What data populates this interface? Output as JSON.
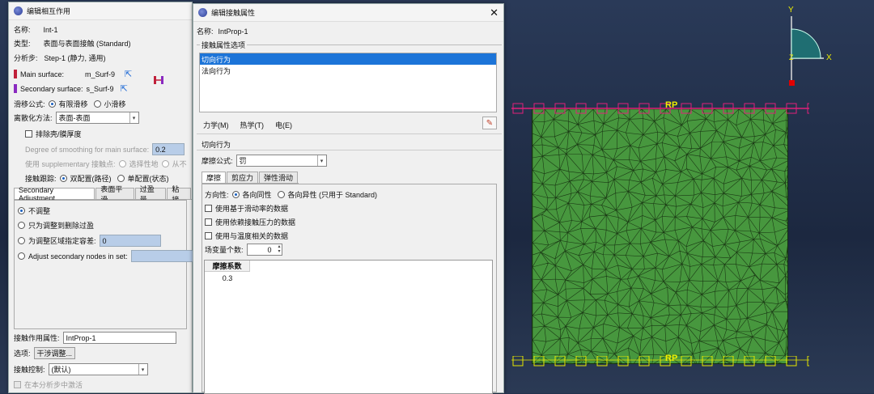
{
  "viewport": {
    "rp_top": "RP",
    "rp_bottom": "RP",
    "triad": {
      "y": "Y",
      "x": "X",
      "z": "Z"
    },
    "colors": {
      "mesh": "#47973e",
      "edges": "#1b3a15",
      "constraint_top": "#e0207a",
      "constraint_bottom": "#e6e600",
      "triad": "#1f6e72"
    }
  },
  "left_dialog": {
    "title": "编辑相互作用",
    "name_label": "名称:",
    "name_value": "Int-1",
    "type_label": "类型:",
    "type_value": "表面与表面接触 (Standard)",
    "step_label": "分析步:",
    "step_value": "Step-1 (静力, 通用)",
    "main_surface_label": "Main surface:",
    "main_surface_value": "m_Surf-9",
    "secondary_surface_label": "Secondary surface:",
    "secondary_surface_value": "s_Surf-9",
    "sliding_label": "滑移公式:",
    "sliding_finite": "有限滑移",
    "sliding_small": "小滑移",
    "discretization_label": "离散化方法:",
    "discretization_value": "表面-表面",
    "exclude_shell": "排除壳/膜厚度",
    "smoothing_label": "Degree of smoothing for main surface:",
    "smoothing_value": "0.2",
    "supplementary_label": "使用 supplementary 接触点:",
    "supplementary_opt1": "选择性地",
    "supplementary_opt2": "从不",
    "tracking_label": "接触跟踪:",
    "tracking_opt1": "双配置(路径)",
    "tracking_opt2": "单配置(状态)",
    "tabs": [
      "Secondary Adjustment",
      "表面平滑",
      "过盈量",
      "粘接"
    ],
    "adjust_none": "不调整",
    "adjust_remove": "只为调整到删除过盈",
    "adjust_tolerance": "为调整区域指定容差:",
    "adjust_tolerance_value": "0",
    "adjust_nodes": "Adjust secondary nodes in set:",
    "property_label": "接触作用属性:",
    "property_value": "IntProp-1",
    "options_label": "选项:",
    "options_button": "干涉调整...",
    "control_label": "接触控制:",
    "control_value": "(默认)",
    "activate_label": "在本分析步中激活"
  },
  "right_dialog": {
    "title": "编辑接触属性",
    "name_label": "名称:",
    "name_value": "IntProp-1",
    "options_group": "接触属性选项",
    "options": [
      "切向行为",
      "法向行为"
    ],
    "menus": [
      "力学(M)",
      "热学(T)",
      "电(E)"
    ],
    "section_title": "切向行为",
    "friction_label": "摩擦公式:",
    "friction_value": "罚",
    "tabs": [
      "摩擦",
      "剪应力",
      "弹性滑动"
    ],
    "direction_label": "方向性:",
    "direction_iso": "各向同性",
    "direction_aniso": "各向异性 (只用于 Standard)",
    "chk_slip": "使用基于滑动率的数据",
    "chk_pressure": "使用依赖接触压力的数据",
    "chk_temp": "使用与温度相关的数据",
    "field_vars_label": "场变量个数:",
    "field_vars_value": "0",
    "table_header": "摩擦系数",
    "table_value": "0.3"
  }
}
